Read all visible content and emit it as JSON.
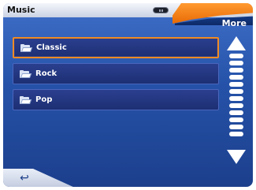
{
  "window": {
    "title": "Music"
  },
  "header": {
    "more_label": "More"
  },
  "list": {
    "items": [
      {
        "label": "Classic",
        "selected": true,
        "icon": "folder-icon"
      },
      {
        "label": "Rock",
        "selected": false,
        "icon": "folder-icon"
      },
      {
        "label": "Pop",
        "selected": false,
        "icon": "folder-icon"
      }
    ]
  },
  "scroll": {
    "up_icon": "arrow-up-icon",
    "down_icon": "arrow-down-icon"
  },
  "footer": {
    "back_icon": "back-arrow-icon",
    "back_glyph": "↩"
  },
  "colors": {
    "accent": "#f08a24",
    "background": "#2552a8",
    "item": "#1d2f73"
  }
}
